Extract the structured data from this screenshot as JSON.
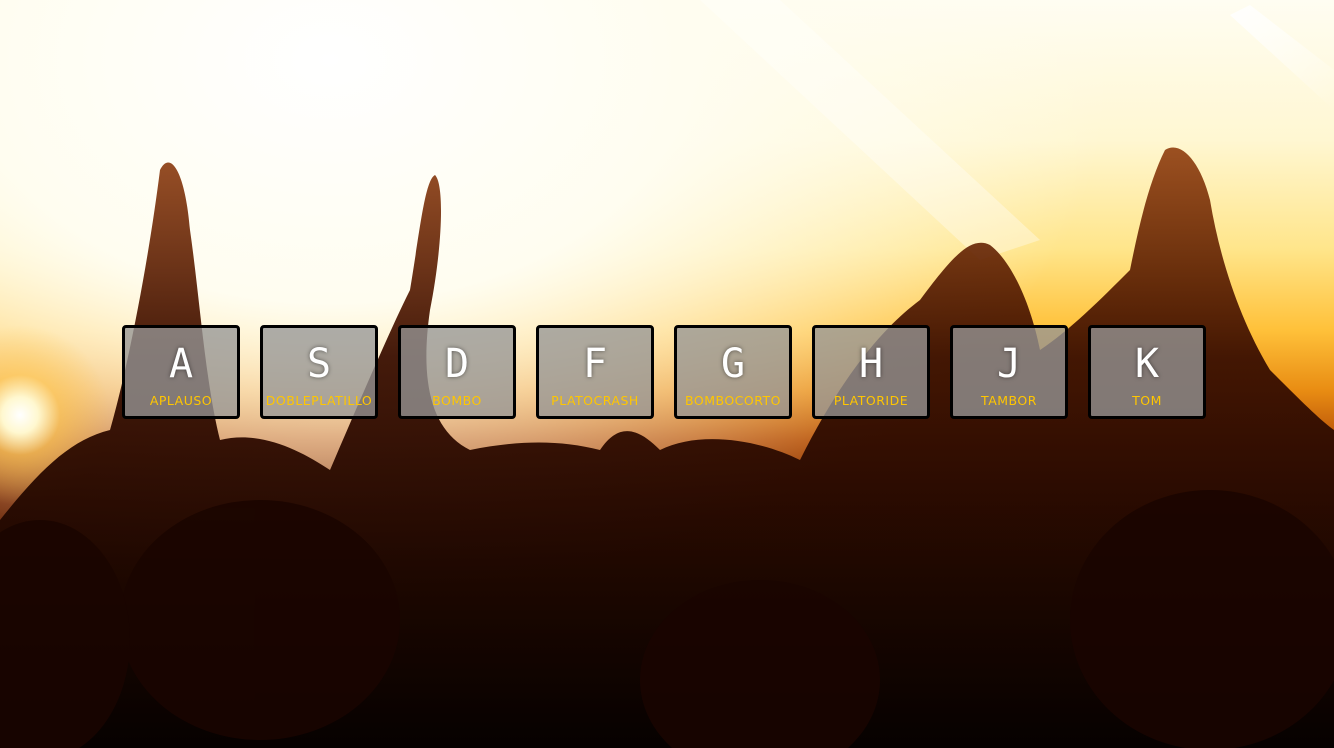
{
  "keys": [
    {
      "letter": "A",
      "sound": "APLAUSO"
    },
    {
      "letter": "S",
      "sound": "DOBLEPLATILLO"
    },
    {
      "letter": "D",
      "sound": "BOMBO"
    },
    {
      "letter": "F",
      "sound": "PLATOCRASH"
    },
    {
      "letter": "G",
      "sound": "BOMBOCORTO"
    },
    {
      "letter": "H",
      "sound": "PLATORIDE"
    },
    {
      "letter": "J",
      "sound": "TAMBOR"
    },
    {
      "letter": "K",
      "sound": "TOM"
    }
  ],
  "colors": {
    "key_letter": "#ffffff",
    "key_sound": "#ffc600",
    "key_border": "#000000",
    "key_background": "#969696"
  }
}
